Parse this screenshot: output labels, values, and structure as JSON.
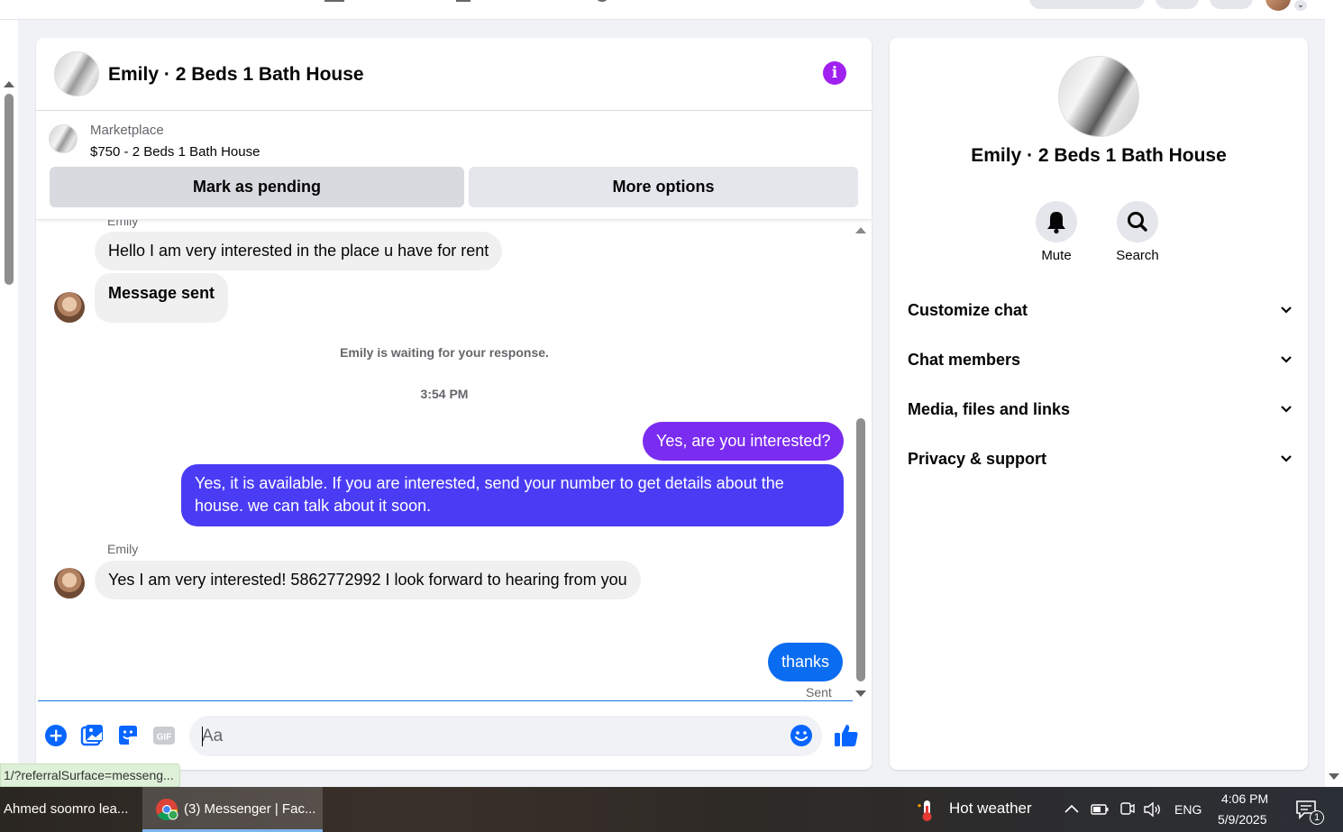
{
  "chat": {
    "title": "Emily · 2 Beds 1 Bath House",
    "listing": {
      "label": "Marketplace",
      "price_title": "$750 - 2 Beds 1 Bath House",
      "mark_pending": "Mark as pending",
      "more_options": "More options"
    },
    "messages": {
      "sender_top": "Emily",
      "m1": "Hello I am very interested in the place u have for rent",
      "m2": "Message sent",
      "waiting_note": "Emily is waiting for your response.",
      "time_divider": "3:54 PM",
      "m3": "Yes, are you interested?",
      "m4_line1": "Yes, it is available. If you are interested, send your number to get details about the",
      "m4_line2": "house. we can talk about it soon.",
      "sender_mid": "Emily",
      "m5": "Yes I am very interested! 5862772992 I look forward to hearing from you",
      "m6": "thanks",
      "status": "Sent"
    },
    "composer": {
      "placeholder": "Aa",
      "gif_label": "GIF"
    },
    "colors": {
      "outgoing_top": "#7a2cf0",
      "outgoing_mid": "#4a3cf5",
      "outgoing_bottom": "#0a6cf0",
      "accent": "#0866ff",
      "info_button": "#a020f0"
    }
  },
  "info_panel": {
    "title": "Emily · 2 Beds 1 Bath House",
    "actions": [
      {
        "label": "Mute",
        "icon": "bell-icon"
      },
      {
        "label": "Search",
        "icon": "search-icon"
      }
    ],
    "sections": [
      "Customize chat",
      "Chat members",
      "Media, files and links",
      "Privacy & support"
    ]
  },
  "browser_status": {
    "url": "1/?referralSurface=messeng..."
  },
  "taskbar": {
    "item1": "Ahmed soomro lea...",
    "item2": "(3) Messenger | Fac...",
    "weather": "Hot weather",
    "language": "ENG",
    "time": "4:06 PM",
    "date": "5/9/2025",
    "notification_count": "1"
  }
}
